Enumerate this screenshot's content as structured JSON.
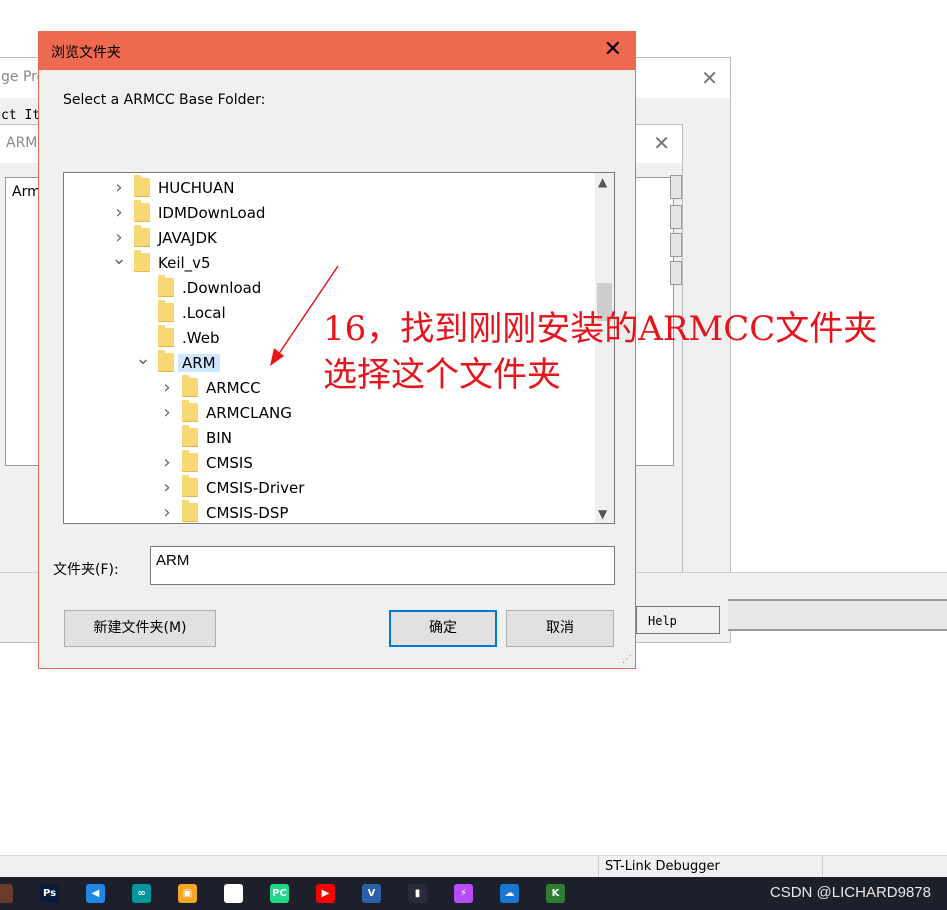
{
  "background": {
    "win1_title": "ge Pro",
    "win1_menu": "ct It",
    "win2_title": "ARM",
    "win2_list_header": "Arm",
    "help_label": "Help"
  },
  "dialog": {
    "title": "浏览文件夹",
    "prompt": "Select a ARMCC Base Folder:",
    "tree": [
      {
        "label": "HUCHUAN",
        "chevron": "right",
        "level": 0
      },
      {
        "label": "IDMDownLoad",
        "chevron": "right",
        "level": 0
      },
      {
        "label": "JAVAJDK",
        "chevron": "right",
        "level": 0
      },
      {
        "label": "Keil_v5",
        "chevron": "down",
        "level": 0
      },
      {
        "label": ".Download",
        "chevron": "",
        "level": 1
      },
      {
        "label": ".Local",
        "chevron": "",
        "level": 1
      },
      {
        "label": ".Web",
        "chevron": "",
        "level": 1
      },
      {
        "label": "ARM",
        "chevron": "down",
        "level": 1,
        "selected": true
      },
      {
        "label": "ARMCC",
        "chevron": "right",
        "level": 2
      },
      {
        "label": "ARMCLANG",
        "chevron": "right",
        "level": 2
      },
      {
        "label": "BIN",
        "chevron": "",
        "level": 2
      },
      {
        "label": "CMSIS",
        "chevron": "right",
        "level": 2
      },
      {
        "label": "CMSIS-Driver",
        "chevron": "right",
        "level": 2
      },
      {
        "label": "CMSIS-DSP",
        "chevron": "right",
        "level": 2
      }
    ],
    "folder_label": "文件夹(F):",
    "folder_value": "ARM",
    "new_folder_button": "新建文件夹(M)",
    "ok_button": "确定",
    "cancel_button": "取消"
  },
  "annotation": {
    "line1": "16，找到刚刚安装的ARMCC文件夹",
    "line2": "选择这个文件夹",
    "color": "#e8141b"
  },
  "statusbar": {
    "debugger": "ST-Link Debugger"
  },
  "taskbar": {
    "icons": [
      "chrome-icon",
      "photoshop-icon",
      "vscode-icon",
      "arduino-icon",
      "app-icon",
      "file-icon",
      "pycharm-icon",
      "youtube-icon",
      "v-icon",
      "dark-app-icon",
      "purple-app-icon",
      "cloud-icon",
      "keil-icon"
    ],
    "watermark": "CSDN @LICHARD9878"
  }
}
